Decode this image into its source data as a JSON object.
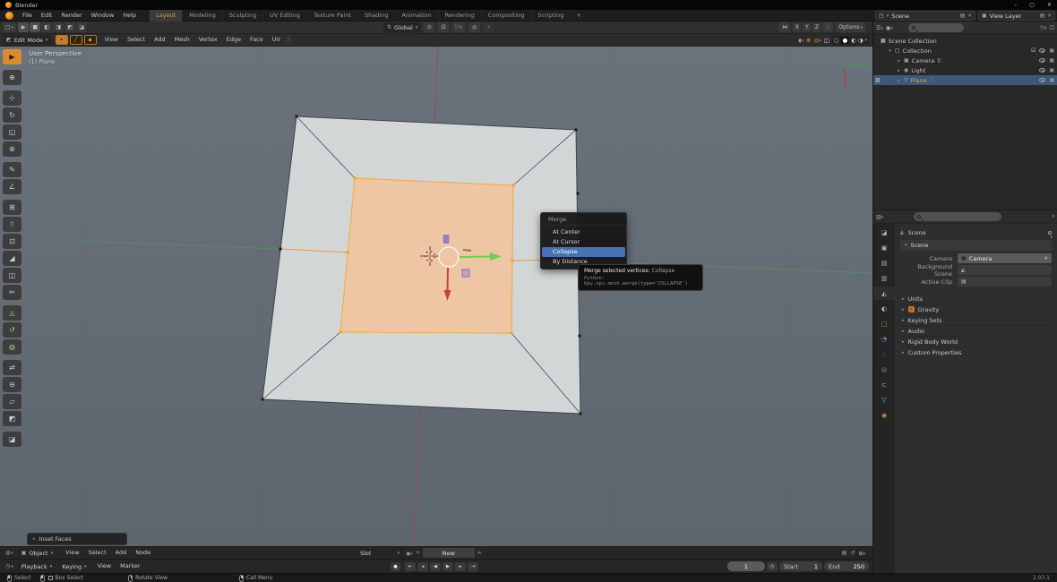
{
  "window": {
    "app_title": "Blender",
    "minimize_glyph": "–",
    "maximize_glyph": "▢",
    "close_glyph": "✕"
  },
  "topbar": {
    "menus": [
      "File",
      "Edit",
      "Render",
      "Window",
      "Help"
    ],
    "tabs": [
      "Layout",
      "Modeling",
      "Sculpting",
      "UV Editing",
      "Texture Paint",
      "Shading",
      "Animation",
      "Rendering",
      "Compositing",
      "Scripting"
    ],
    "add_tab_label": "+",
    "scene_value": "Scene",
    "view_layer_value": "View Layer"
  },
  "tool_settings": {
    "orientation_value": "Global",
    "mirror_x": "X",
    "mirror_y": "Y",
    "mirror_z": "Z",
    "options_label": "Options"
  },
  "viewport_header": {
    "mode_value": "Edit Mode",
    "menus": [
      "View",
      "Select",
      "Add",
      "Mesh",
      "Vertex",
      "Edge",
      "Face",
      "UV"
    ]
  },
  "viewport": {
    "overlay_title": "User Perspective",
    "overlay_subtitle": "(1) Plane",
    "operator_panel_label": "Inset Faces",
    "tools": [
      {
        "name": "select-box-tool",
        "glyph": "▶"
      },
      {
        "name": "cursor-tool",
        "glyph": "⊕"
      },
      {
        "name": "move-tool",
        "glyph": "⊹"
      },
      {
        "name": "rotate-tool",
        "glyph": "↻"
      },
      {
        "name": "scale-tool",
        "glyph": "◱"
      },
      {
        "name": "transform-tool",
        "glyph": "⊛"
      },
      {
        "name": "annotate-tool",
        "glyph": "✎"
      },
      {
        "name": "measure-tool",
        "glyph": "∠"
      },
      {
        "name": "add-cube-tool",
        "glyph": "⊞"
      },
      {
        "name": "extrude-region-tool",
        "glyph": "⇧"
      },
      {
        "name": "inset-faces-tool",
        "glyph": "⊡"
      },
      {
        "name": "bevel-tool",
        "glyph": "◢"
      },
      {
        "name": "loop-cut-tool",
        "glyph": "◫"
      },
      {
        "name": "knife-tool",
        "glyph": "✂"
      },
      {
        "name": "poly-build-tool",
        "glyph": "◬"
      },
      {
        "name": "spin-tool",
        "glyph": "↺"
      },
      {
        "name": "smooth-tool",
        "glyph": "◍"
      },
      {
        "name": "edge-slide-tool",
        "glyph": "⇄"
      },
      {
        "name": "shrink-fatten-tool",
        "glyph": "⊖"
      },
      {
        "name": "shear-tool",
        "glyph": "▱"
      },
      {
        "name": "rip-region-tool",
        "glyph": "◩"
      },
      {
        "name": "rip-edge-tool",
        "glyph": "◪"
      }
    ]
  },
  "merge_menu": {
    "title": "Merge",
    "items": [
      "At Center",
      "At Cursor",
      "Collapse",
      "By Distance"
    ],
    "highlighted_item": "Collapse"
  },
  "tooltip": {
    "label": "Merge selected vertices:",
    "value": "Collapse",
    "python": "Python: bpy.ops.mesh.merge(type='COLLAPSE')"
  },
  "outliner": {
    "rows": [
      {
        "label": "Scene Collection"
      },
      {
        "label": "Collection"
      },
      {
        "label": "Camera"
      },
      {
        "label": "Light"
      },
      {
        "label": "Plane"
      }
    ]
  },
  "properties": {
    "breadcrumb_value": "Scene",
    "panel_title": "Scene",
    "camera_label": "Camera",
    "camera_value": "Camera",
    "background_scene_label": "Background Scene",
    "active_clip_label": "Active Clip",
    "sections": [
      "Units",
      "Gravity",
      "Keying Sets",
      "Audio",
      "Rigid Body World",
      "Custom Properties"
    ],
    "tabs": [
      {
        "name": "tool",
        "glyph": "◪"
      },
      {
        "name": "render",
        "glyph": "▣"
      },
      {
        "name": "output",
        "glyph": "▤"
      },
      {
        "name": "view-layer",
        "glyph": "▥"
      },
      {
        "name": "scene",
        "glyph": "◭"
      },
      {
        "name": "world",
        "glyph": "◐"
      },
      {
        "name": "object",
        "glyph": "□"
      },
      {
        "name": "modifiers",
        "glyph": "◔"
      },
      {
        "name": "particles",
        "glyph": "∴"
      },
      {
        "name": "physics",
        "glyph": "◎"
      },
      {
        "name": "constraints",
        "glyph": "⊂"
      },
      {
        "name": "object-data",
        "glyph": "▽"
      },
      {
        "name": "material",
        "glyph": "◉"
      }
    ]
  },
  "shader_editor": {
    "mode_value": "Object",
    "menus": [
      "View",
      "Select",
      "Add",
      "Node"
    ],
    "slot_label": "Slot",
    "new_label": "New"
  },
  "timeline": {
    "menus": [
      "Playback",
      "Keying",
      "View",
      "Marker"
    ],
    "current_frame": "1",
    "start_label": "Start",
    "start_value": "1",
    "end_label": "End",
    "end_value": "250"
  },
  "status_bar": {
    "hints": [
      "Select",
      "Box Select",
      "Rotate View",
      "Call Menu"
    ],
    "version": "2.93.1"
  },
  "colors": {
    "accent_orange": "#e08e3c",
    "selection_blue": "#4772b3",
    "selected_face": "#eec6a3",
    "axis_green": "#55935a",
    "axis_red": "#9c4a4c"
  }
}
